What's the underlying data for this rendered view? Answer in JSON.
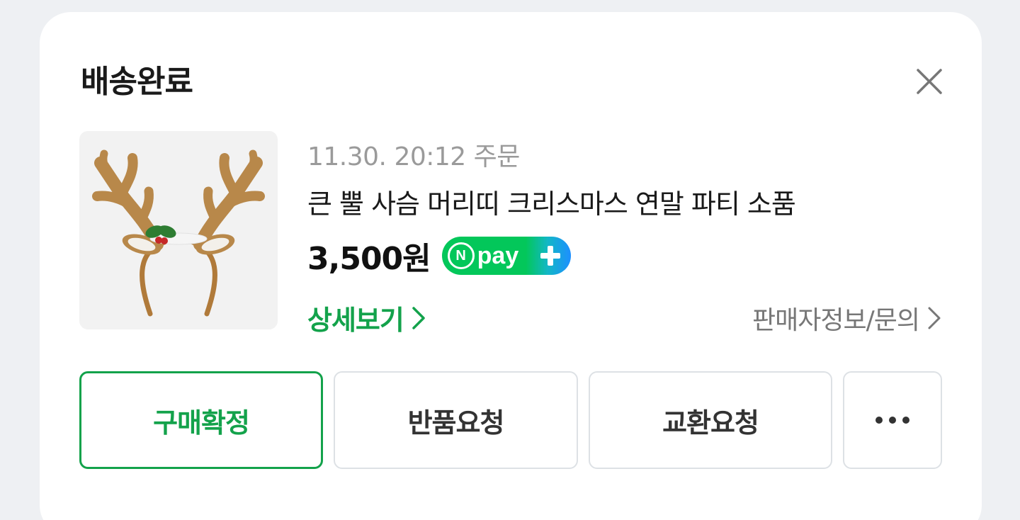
{
  "order": {
    "status": "배송완료",
    "date": "11.30. 20:12 주문",
    "product_name": "큰 뿔 사슴 머리띠 크리스마스 연말 파티 소품",
    "price": "3,500원",
    "npay": {
      "n_label": "N",
      "label": "pay"
    },
    "detail_link": "상세보기",
    "seller_link": "판매자정보/문의"
  },
  "actions": {
    "confirm": "구매확정",
    "return": "반품요청",
    "exchange": "교환요청"
  },
  "colors": {
    "accent": "#13a24b",
    "npay_green": "#03c75a",
    "npay_blue": "#1e8fff"
  },
  "icons": {
    "close": "close-icon",
    "chevron": "chevron-right-icon",
    "more": "more-icon"
  }
}
